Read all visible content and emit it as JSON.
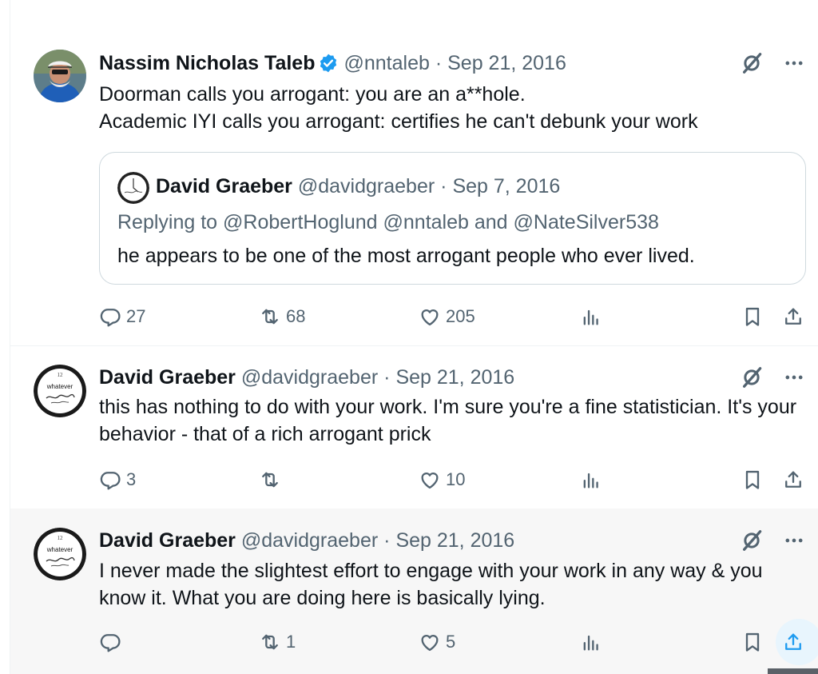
{
  "colors": {
    "text": "#0f1419",
    "secondary": "#536471",
    "accent": "#1d9bf0",
    "border": "#cfd9de",
    "highlight_bg": "#f7f7f7"
  },
  "tweets": [
    {
      "name": "Nassim Nicholas Taleb",
      "verified": true,
      "handle": "@nntaleb",
      "dot": "·",
      "date": "Sep 21, 2016",
      "lines": [
        "Doorman calls you arrogant: you are an a**hole.",
        "Academic IYI calls you arrogant: certifies he can't debunk your work"
      ],
      "quote": {
        "name": "David Graeber",
        "handle": "@davidgraeber",
        "dot": "·",
        "date": "Sep 7, 2016",
        "replying_to": "Replying to @RobertHoglund @nntaleb and @NateSilver538",
        "text": "he appears to be one of the most arrogant people who ever lived."
      },
      "stats": {
        "replies": "27",
        "reposts": "68",
        "likes": "205"
      }
    },
    {
      "name": "David Graeber",
      "handle": "@davidgraeber",
      "dot": "·",
      "date": "Sep 21, 2016",
      "lines": [
        "this has nothing to do with your work. I'm sure you're a fine statistician. It's your behavior - that of a rich arrogant prick"
      ],
      "stats": {
        "replies": "3",
        "reposts": "",
        "likes": "10"
      }
    },
    {
      "name": "David Graeber",
      "handle": "@davidgraeber",
      "dot": "·",
      "date": "Sep 21, 2016",
      "lines": [
        "I never made the slightest effort to engage with your work in any way & you know it. What you are doing here is basically lying."
      ],
      "stats": {
        "replies": "",
        "reposts": "1",
        "likes": "5"
      }
    }
  ],
  "icons": {
    "back": "arrow-left-icon",
    "verified": "verified-badge-icon",
    "grok": "grok-icon",
    "more": "more-icon",
    "reply": "reply-icon",
    "repost": "repost-icon",
    "like": "heart-icon",
    "views": "views-icon",
    "bookmark": "bookmark-icon",
    "share": "share-icon"
  },
  "avatar_text": {
    "clock_number": "12",
    "clock_word": "whatever"
  }
}
